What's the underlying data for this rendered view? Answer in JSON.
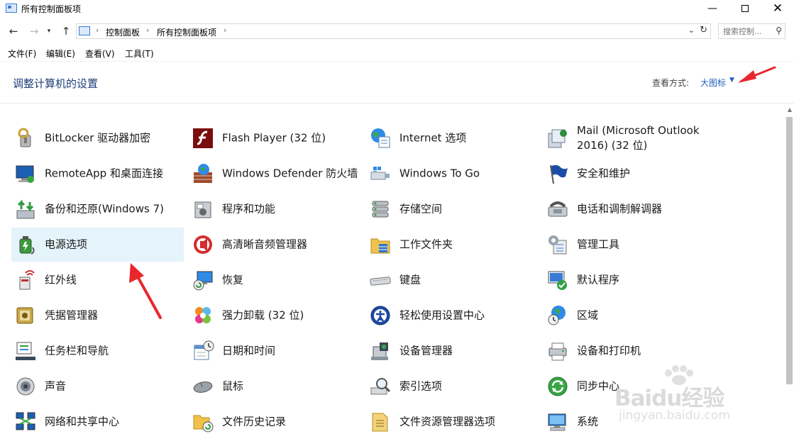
{
  "window": {
    "title": "所有控制面板项"
  },
  "address": {
    "breadcrumbs": [
      "控制面板",
      "所有控制面板项"
    ],
    "search_placeholder": "搜索控制..."
  },
  "menu": [
    "文件(F)",
    "编辑(E)",
    "查看(V)",
    "工具(T)"
  ],
  "header": {
    "title": "调整计算机的设置",
    "view_label": "查看方式:",
    "view_value": "大图标"
  },
  "items": [
    {
      "label": "BitLocker 驱动器加密",
      "icon": "bitlocker-icon"
    },
    {
      "label": "Flash Player (32 位)",
      "icon": "flash-player-icon"
    },
    {
      "label": "Internet 选项",
      "icon": "internet-options-icon"
    },
    {
      "label": "Mail (Microsoft Outlook 2016) (32 位)",
      "icon": "mail-icon"
    },
    {
      "label": "RemoteApp 和桌面连接",
      "icon": "remoteapp-icon"
    },
    {
      "label": "Windows Defender 防火墙",
      "icon": "firewall-icon"
    },
    {
      "label": "Windows To Go",
      "icon": "windows-to-go-icon"
    },
    {
      "label": "安全和维护",
      "icon": "security-flag-icon"
    },
    {
      "label": "备份和还原(Windows 7)",
      "icon": "backup-restore-icon"
    },
    {
      "label": "程序和功能",
      "icon": "programs-features-icon"
    },
    {
      "label": "存储空间",
      "icon": "storage-spaces-icon"
    },
    {
      "label": "电话和调制解调器",
      "icon": "phone-modem-icon"
    },
    {
      "label": "电源选项",
      "icon": "power-options-icon"
    },
    {
      "label": "高清晰音频管理器",
      "icon": "audio-manager-icon"
    },
    {
      "label": "工作文件夹",
      "icon": "work-folders-icon"
    },
    {
      "label": "管理工具",
      "icon": "admin-tools-icon"
    },
    {
      "label": "红外线",
      "icon": "infrared-icon"
    },
    {
      "label": "恢复",
      "icon": "recovery-icon"
    },
    {
      "label": "键盘",
      "icon": "keyboard-icon"
    },
    {
      "label": "默认程序",
      "icon": "default-programs-icon"
    },
    {
      "label": "凭据管理器",
      "icon": "credential-manager-icon"
    },
    {
      "label": "强力卸载 (32 位)",
      "icon": "uninstaller-icon"
    },
    {
      "label": "轻松使用设置中心",
      "icon": "ease-of-access-icon"
    },
    {
      "label": "区域",
      "icon": "region-icon"
    },
    {
      "label": "任务栏和导航",
      "icon": "taskbar-navigation-icon"
    },
    {
      "label": "日期和时间",
      "icon": "date-time-icon"
    },
    {
      "label": "设备管理器",
      "icon": "device-manager-icon"
    },
    {
      "label": "设备和打印机",
      "icon": "devices-printers-icon"
    },
    {
      "label": "声音",
      "icon": "sound-icon"
    },
    {
      "label": "鼠标",
      "icon": "mouse-icon"
    },
    {
      "label": "索引选项",
      "icon": "indexing-options-icon"
    },
    {
      "label": "同步中心",
      "icon": "sync-center-icon"
    },
    {
      "label": "网络和共享中心",
      "icon": "network-sharing-icon"
    },
    {
      "label": "文件历史记录",
      "icon": "file-history-icon"
    },
    {
      "label": "文件资源管理器选项",
      "icon": "explorer-options-icon"
    },
    {
      "label": "系统",
      "icon": "system-icon"
    }
  ],
  "watermark": {
    "main": "Baidu经验",
    "sub": "jingyan.baidu.com"
  },
  "colors": {
    "accent": "#1e5fbf",
    "title_blue": "#1e3c78",
    "hover_bg": "#e5f3fb",
    "annotation_red": "#e8272d"
  }
}
